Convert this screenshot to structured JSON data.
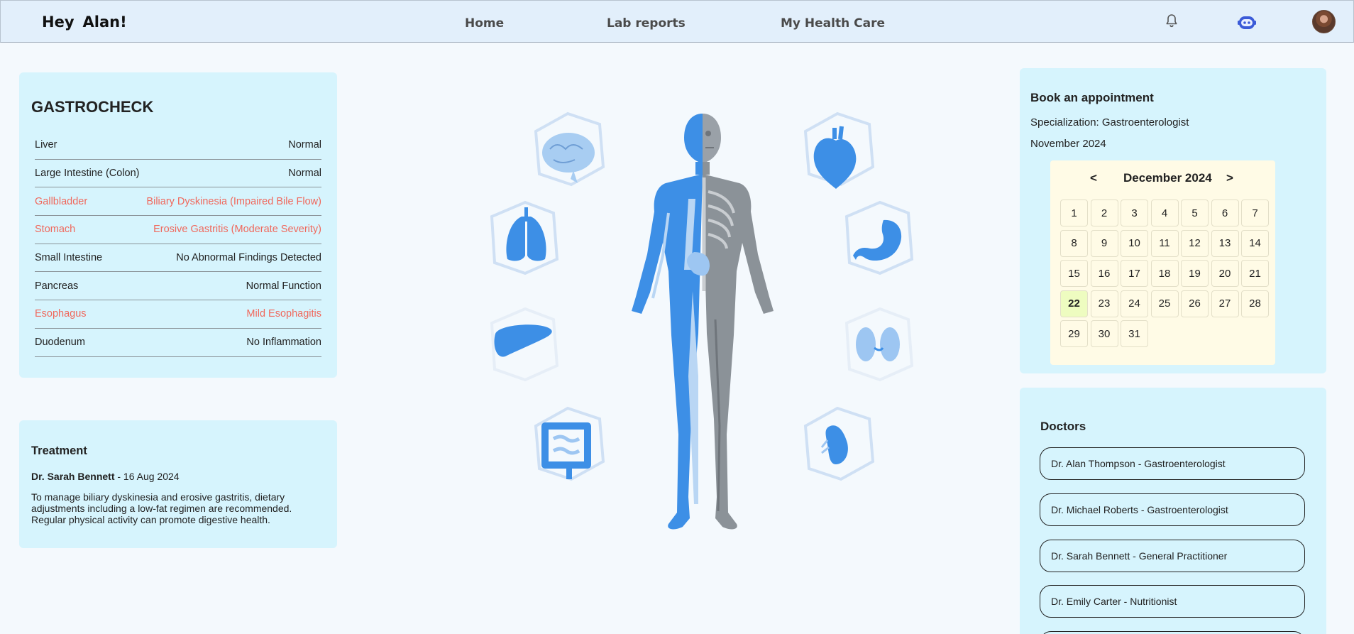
{
  "nav": {
    "greeting_prefix": "Hey",
    "greeting_name": "Alan!",
    "links": [
      "Home",
      "Lab reports",
      "My Health Care"
    ],
    "icons": [
      "bell-icon",
      "chatbot-icon",
      "avatar"
    ]
  },
  "gastrocheck": {
    "title": "GASTROCHECK",
    "rows": [
      {
        "organ": "Liver",
        "result": "Normal",
        "status": "normal"
      },
      {
        "organ": "Large Intestine (Colon)",
        "result": "Normal",
        "status": "normal"
      },
      {
        "organ": "Gallbladder",
        "result": "Biliary Dyskinesia (Impaired Bile Flow)",
        "status": "alert"
      },
      {
        "organ": "Stomach",
        "result": "Erosive Gastritis (Moderate Severity)",
        "status": "alert"
      },
      {
        "organ": "Small Intestine",
        "result": "No Abnormal Findings Detected",
        "status": "normal"
      },
      {
        "organ": "Pancreas",
        "result": "Normal Function",
        "status": "normal"
      },
      {
        "organ": "Esophagus",
        "result": "Mild Esophagitis",
        "status": "alert"
      },
      {
        "organ": "Duodenum",
        "result": "No Inflammation",
        "status": "normal"
      }
    ],
    "alert_color": "#f0685c"
  },
  "treatment": {
    "title": "Treatment",
    "doctor": "Dr. Sarah Bennett",
    "date_suffix": " - 16 Aug 2024",
    "text": "To manage biliary dyskinesia and erosive gastritis, dietary adjustments including a low-fat regimen are recommended. Regular physical activity can promote digestive health."
  },
  "appointment": {
    "title": "Book an appointment",
    "specialization": "Specialization: Gastroenterologist",
    "month_label": "November 2024",
    "calendar": {
      "prev": "<",
      "title": "December 2024",
      "next": ">",
      "days": [
        "1",
        "2",
        "3",
        "4",
        "5",
        "6",
        "7",
        "8",
        "9",
        "10",
        "11",
        "12",
        "13",
        "14",
        "15",
        "16",
        "17",
        "18",
        "19",
        "20",
        "21",
        "22",
        "23",
        "24",
        "25",
        "26",
        "27",
        "28",
        "29",
        "30",
        "31"
      ],
      "selected": "22"
    }
  },
  "doctors": {
    "title": "Doctors",
    "list": [
      "Dr. Alan Thompson - Gastroenterologist",
      "Dr. Michael Roberts - Gastroenterologist",
      "Dr. Sarah Bennett - General Practitioner",
      "Dr. Emily Carter - Nutritionist"
    ]
  },
  "colors": {
    "accent_blue": "#3d8fe6",
    "panel": "#d6f4fd",
    "calendar_bg": "#fffbe6",
    "today_bg": "#eefcc0"
  }
}
